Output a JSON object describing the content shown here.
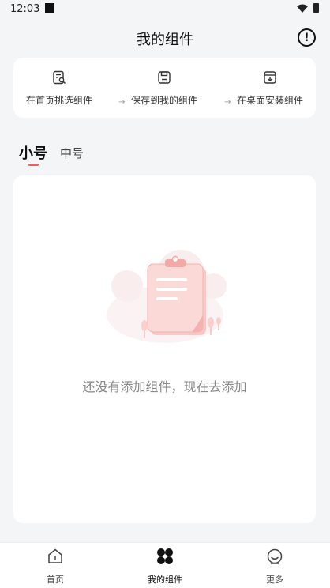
{
  "status_bar": {
    "time": "12:03"
  },
  "header": {
    "title": "我的组件"
  },
  "steps": [
    {
      "label": "在首页挑选组件",
      "icon": "search-document-icon"
    },
    {
      "label": "保存到我的组件",
      "icon": "save-icon"
    },
    {
      "label": "在桌面安装组件",
      "icon": "install-icon"
    }
  ],
  "step_arrow": "→",
  "tabs": {
    "small": "小号",
    "medium": "中号",
    "active": "small"
  },
  "empty_state": {
    "message": "还没有添加组件，现在去添加",
    "illustration": "clipboard-illustration"
  },
  "bottom_nav": [
    {
      "label": "首页",
      "icon": "home-icon"
    },
    {
      "label": "我的组件",
      "icon": "widgets-icon",
      "active": true
    },
    {
      "label": "更多",
      "icon": "profile-icon"
    }
  ],
  "colors": {
    "accent": "#ef5d5d",
    "background": "#f4f5f7",
    "card": "#ffffff"
  }
}
